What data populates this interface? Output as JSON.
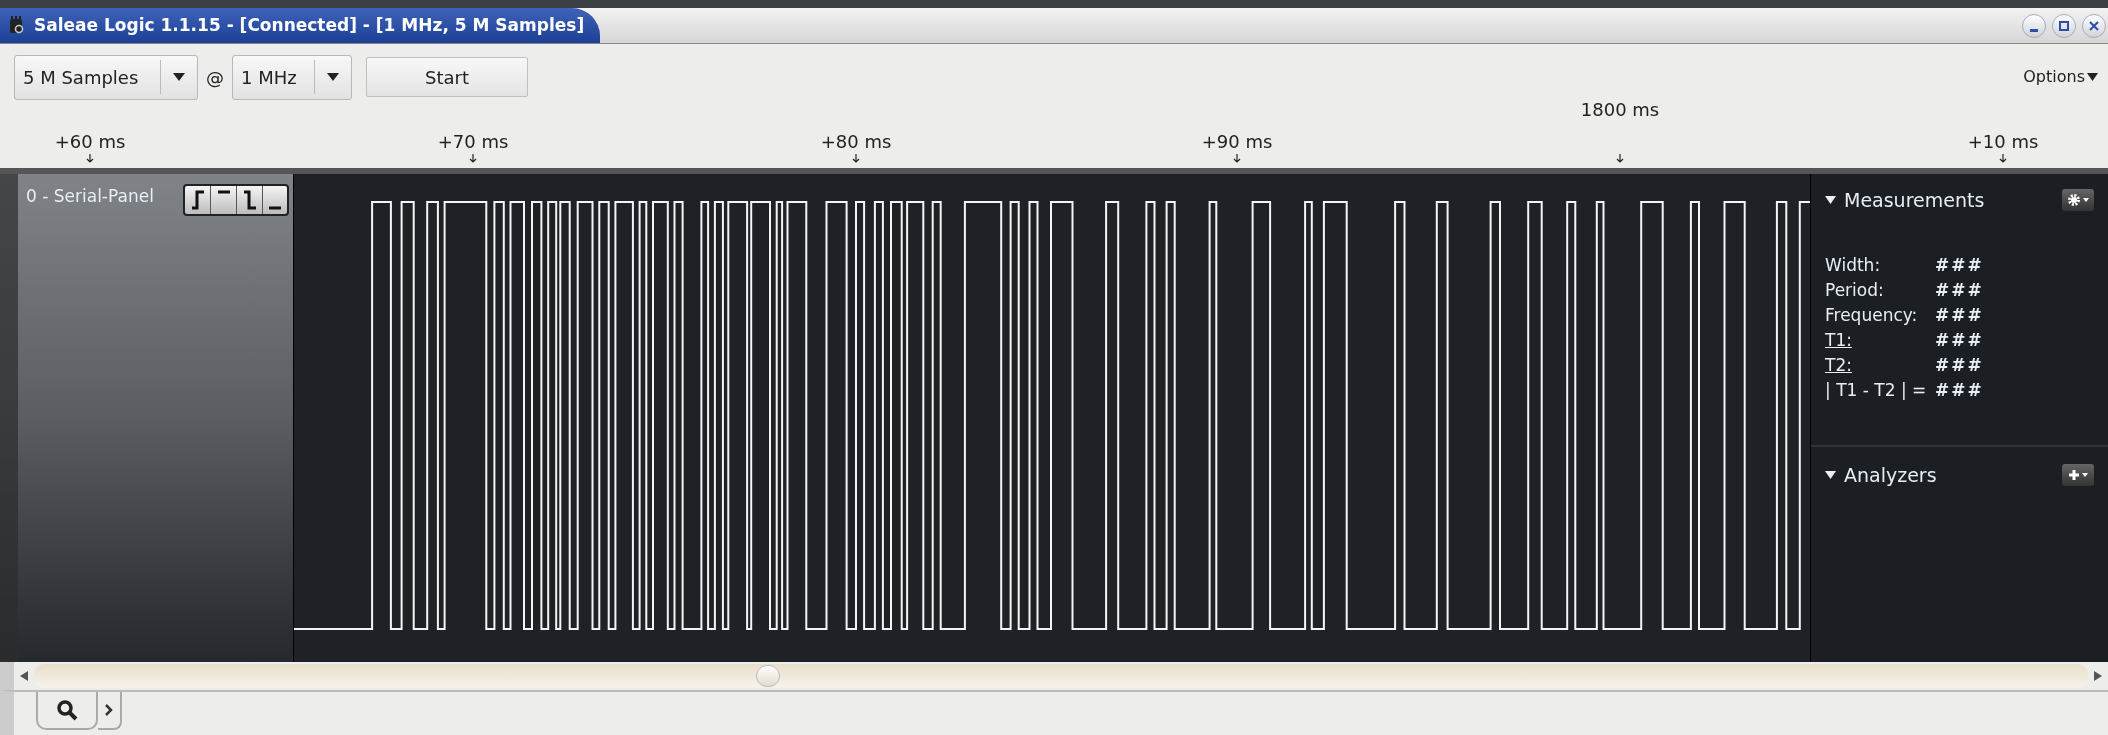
{
  "window": {
    "title": "Saleae Logic 1.1.15 - [Connected] - [1 MHz, 5 M Samples]"
  },
  "toolbar": {
    "samples": "5 M Samples",
    "at": "@",
    "rate": "1 MHz",
    "start_button": "Start",
    "options": "Options"
  },
  "ruler": {
    "ticks": [
      "+60 ms",
      "+70 ms",
      "+80 ms",
      "+90 ms",
      "+10 ms"
    ],
    "cursor": "1800 ms"
  },
  "channel": {
    "label": "0 - Serial-Panel"
  },
  "measurements": {
    "title": "Measurements",
    "rows": [
      {
        "label": "Width:",
        "value": "###",
        "underlined": false
      },
      {
        "label": "Period:",
        "value": "###",
        "underlined": false
      },
      {
        "label": "Frequency:",
        "value": "###",
        "underlined": false
      },
      {
        "label": "T1:",
        "value": "###",
        "underlined": true
      },
      {
        "label": "T2:",
        "value": "###",
        "underlined": true
      },
      {
        "label": "| T1 - T2 | =",
        "value": "###",
        "underlined": false
      }
    ]
  },
  "analyzers": {
    "title": "Analyzers"
  }
}
